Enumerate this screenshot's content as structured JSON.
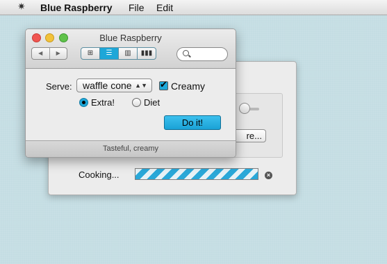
{
  "menubar": {
    "apple_glyph": "✷",
    "app_name": "Blue Raspberry",
    "file": "File",
    "edit": "Edit"
  },
  "back_window": {
    "more_button_label": "re...",
    "cooking_label": "Cooking...",
    "progress_fraction": 1.0,
    "cancel_glyph": "×"
  },
  "front_window": {
    "title": "Blue Raspberry",
    "nav": {
      "back": "◀",
      "forward": "▶"
    },
    "view_modes": [
      {
        "icon": "icon-view-icon",
        "glyph": "⊞"
      },
      {
        "icon": "list-view-icon",
        "glyph": "☰"
      },
      {
        "icon": "column-view-icon",
        "glyph": "▥"
      },
      {
        "icon": "coverflow-view-icon",
        "glyph": "▮▮▮"
      }
    ],
    "selected_view": 1,
    "search_placeholder": "",
    "serve_label": "Serve:",
    "serve_value": "waffle cone",
    "popup_arrow": "▲▼",
    "creamy_label": "Creamy",
    "creamy_checked": true,
    "radio_extra_label": "Extra!",
    "radio_diet_label": "Diet",
    "selected_radio": "Extra!",
    "do_it_label": "Do it!",
    "status_text": "Tasteful, creamy"
  },
  "colors": {
    "accent": "#1ea7d8",
    "desktop": "#c4dde3"
  }
}
